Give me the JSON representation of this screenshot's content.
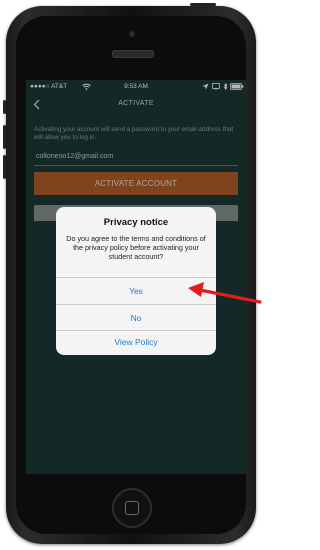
{
  "status_bar": {
    "carrier": "●●●●○ AT&T",
    "time": "9:53 AM"
  },
  "nav": {
    "title": "ACTIVATE",
    "back_icon": "chevron-left-icon"
  },
  "form": {
    "intro": "Activating your account will send a password to your email address that will allow you to log in.",
    "email": "coltoneoo12@gmail.com",
    "activate_label": "ACTIVATE ACCOUNT"
  },
  "dialog": {
    "title": "Privacy notice",
    "message": "Do you agree to the terms and conditions of the privacy policy before activating your student account?",
    "yes": "Yes",
    "no": "No",
    "view_policy": "View Policy"
  },
  "colors": {
    "screen_bg": "#1d3a37",
    "accent_button": "#b05d2a",
    "dialog_link": "#1a7bd6",
    "annotation_arrow": "#e31c1c"
  }
}
